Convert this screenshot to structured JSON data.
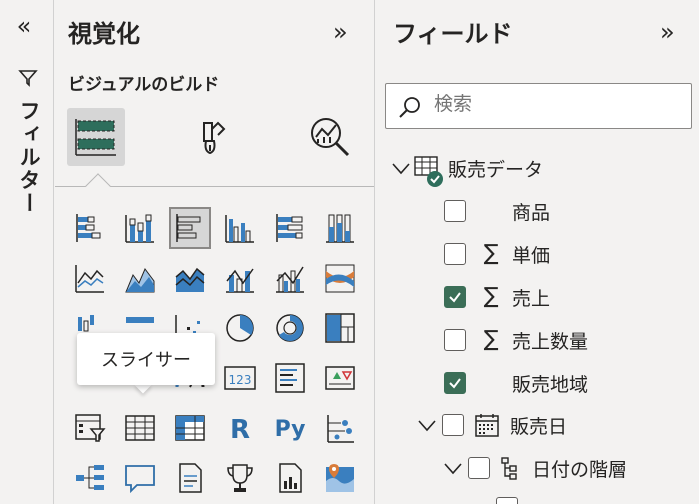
{
  "filters": {
    "label": "フィルター"
  },
  "visualizations": {
    "title": "視覚化",
    "subtitle": "ビジュアルのビルド",
    "tooltip": "スライサー"
  },
  "fields": {
    "title": "フィールド",
    "search_placeholder": "検索",
    "table": {
      "name": "販売データ",
      "items": [
        {
          "label": "商品",
          "checked": false,
          "sigma": false
        },
        {
          "label": "単価",
          "checked": false,
          "sigma": true
        },
        {
          "label": "売上",
          "checked": true,
          "sigma": true
        },
        {
          "label": "売上数量",
          "checked": false,
          "sigma": true
        },
        {
          "label": "販売地域",
          "checked": true,
          "sigma": false
        }
      ]
    },
    "date_field": "販売日",
    "date_hierarchy": "日付の階層"
  },
  "colors": {
    "accent_teal": "#2e6e5c",
    "check_green": "#3b6e57",
    "chart_blue": "#3a7fbf",
    "chart_light": "#9fc3e6"
  }
}
